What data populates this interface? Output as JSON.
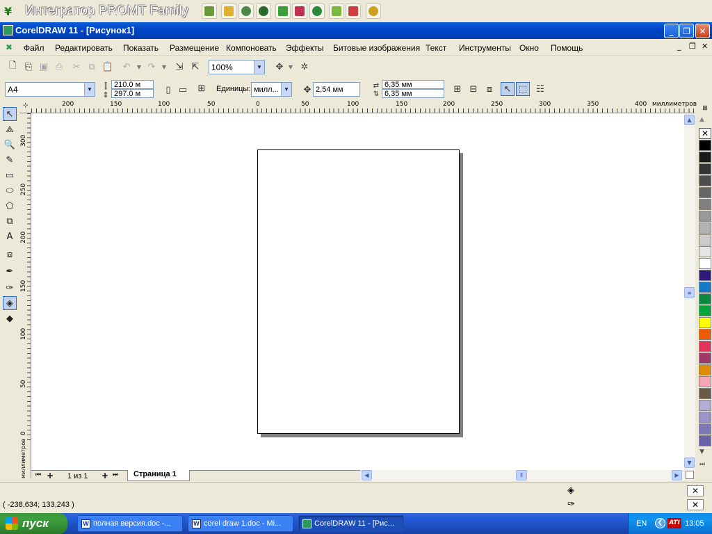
{
  "promt": {
    "title": "Интегратор PROMT Family",
    "icons": [
      "promt-logo-icon",
      "translate-file-icon",
      "open-folder-icon",
      "dictionary-icon",
      "web-translate-icon",
      "filter-icon",
      "book-icon",
      "globe-icon",
      "mail-icon",
      "book-open-icon",
      "settings-gear-icon"
    ]
  },
  "window": {
    "title": "CorelDRAW 11 - [Рисунок1]"
  },
  "menu": {
    "items": [
      "Файл",
      "Редактировать",
      "Показать",
      "Размещение",
      "Компоновать",
      "Эффекты",
      "Битовые изображения",
      "Текст",
      "Инструменты",
      "Окно",
      "Помощь"
    ]
  },
  "toolbar": {
    "zoom": "100%"
  },
  "property_bar": {
    "paper": "A4",
    "width": "210.0 м",
    "height": "297.0 м",
    "units_label": "Единицы:",
    "units": "милл...",
    "nudge": "2,54 мм",
    "dup_x": "6,35 мм",
    "dup_y": "6,35 мм"
  },
  "ruler": {
    "units": "миллиметров",
    "h_ticks": [
      "200",
      "150",
      "100",
      "50",
      "0",
      "50",
      "100",
      "150",
      "200",
      "250",
      "300",
      "350",
      "400"
    ],
    "v_ticks": [
      "300",
      "250",
      "200",
      "150",
      "100",
      "50",
      "0"
    ]
  },
  "page_nav": {
    "counter": "1 из 1",
    "tab": "Страница 1"
  },
  "status": {
    "coords": "( -238,634; 133,243 )"
  },
  "palette": {
    "colors": [
      "#000000",
      "#1a1a1a",
      "#333333",
      "#4d4d4d",
      "#666666",
      "#808080",
      "#999999",
      "#b3b3b3",
      "#cccccc",
      "#e6e6e6",
      "#ffffff",
      "#2e1a78",
      "#1479c8",
      "#0a8a3c",
      "#00a63c",
      "#ffff00",
      "#f05a00",
      "#e3345a",
      "#a0396a",
      "#e08a00",
      "#f4a6b4",
      "#6a5a48",
      "#b4aed6",
      "#9a94c8",
      "#7e78b8",
      "#6a62a8"
    ]
  },
  "taskbar": {
    "start": "пуск",
    "tasks": [
      "полная версия.doc -...",
      "corel draw 1.doc - Mi...",
      "CorelDRAW 11 - [Рис..."
    ],
    "lang": "EN",
    "clock": "13:05"
  }
}
